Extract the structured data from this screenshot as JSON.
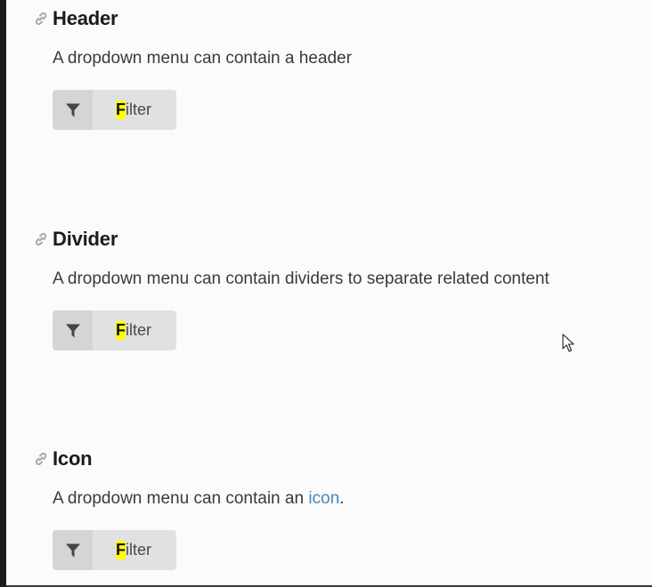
{
  "sections": [
    {
      "title": "Header",
      "description": "A dropdown menu can contain a header",
      "button": {
        "highlight": "F",
        "rest": "ilter"
      }
    },
    {
      "title": "Divider",
      "description": "A dropdown menu can contain dividers to separate related content",
      "button": {
        "highlight": "F",
        "rest": "ilter"
      }
    },
    {
      "title": "Icon",
      "description_prefix": "A dropdown menu can contain an ",
      "description_link": "icon",
      "description_suffix": ".",
      "button": {
        "highlight": "F",
        "rest": "ilter"
      }
    }
  ],
  "icons": {
    "section_link": "link-icon",
    "button": "filter-icon"
  },
  "colors": {
    "background": "#fbfbfb",
    "button_bg": "#e0e1e2",
    "button_icon_bg": "#d4d5d6",
    "highlight": "#ffff00",
    "link": "#4b86b8"
  }
}
